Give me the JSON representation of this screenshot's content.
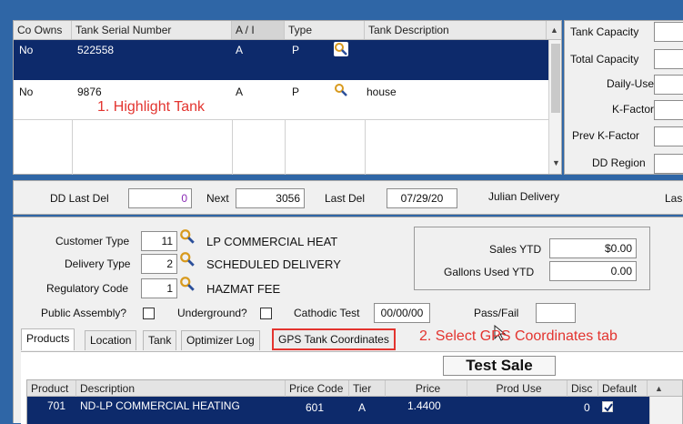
{
  "tank_grid": {
    "columns": [
      "Co Owns",
      "Tank Serial Number",
      "A / I",
      "Type",
      "Tank Description"
    ],
    "rows": [
      {
        "co_owns": "No",
        "serial": "522558",
        "ai": "A",
        "type": "P",
        "description": ""
      },
      {
        "co_owns": "No",
        "serial": "9876",
        "ai": "A",
        "type": "P",
        "description": "house"
      }
    ]
  },
  "right_fields": {
    "labels": [
      "Tank Capacity",
      "Total Capacity",
      "Daily-Use",
      "K-Factor",
      "Prev K-Factor",
      "DD Region"
    ]
  },
  "annotations": {
    "step1": "1. Highlight Tank",
    "step2": "2. Select GPS Coordinates tab"
  },
  "delivery_bar": {
    "dd_last_del_label": "DD Last Del",
    "dd_last_del_value": "0",
    "next_label": "Next",
    "next_value": "3056",
    "last_del_label": "Last Del",
    "last_del_value": "07/29/20",
    "julian_label": "Julian Delivery",
    "cut_label": "Las"
  },
  "customer": {
    "customer_type_label": "Customer Type",
    "customer_type_code": "11",
    "customer_type_desc": "LP COMMERCIAL HEAT",
    "delivery_type_label": "Delivery Type",
    "delivery_type_code": "2",
    "delivery_type_desc": "SCHEDULED DELIVERY",
    "regulatory_label": "Regulatory Code",
    "regulatory_code": "1",
    "regulatory_desc": "HAZMAT FEE"
  },
  "sales": {
    "sales_ytd_label": "Sales YTD",
    "sales_ytd_value": "$0.00",
    "gallons_label": "Gallons Used YTD",
    "gallons_value": "0.00"
  },
  "checks": {
    "public_assembly": "Public Assembly?",
    "underground": "Underground?",
    "cathodic_label": "Cathodic Test",
    "cathodic_value": "00/00/00",
    "pass_fail_label": "Pass/Fail"
  },
  "tabs": [
    "Products",
    "Location",
    "Tank",
    "Optimizer Log",
    "GPS Tank Coordinates"
  ],
  "test_sale_label": "Test Sale",
  "product_grid": {
    "columns": [
      "Product",
      "Description",
      "Price Code",
      "Tier",
      "Price",
      "Prod Use",
      "Disc",
      "Default"
    ],
    "row": {
      "product": "701",
      "description": "ND-LP COMMERCIAL HEATING",
      "price_code": "601",
      "tier": "A",
      "price": "1.4400",
      "disc": "0"
    }
  },
  "colors": {
    "window_bg": "#2f66a6",
    "selected_row": "#0d2a6b",
    "annotation_red": "#e3342f"
  }
}
